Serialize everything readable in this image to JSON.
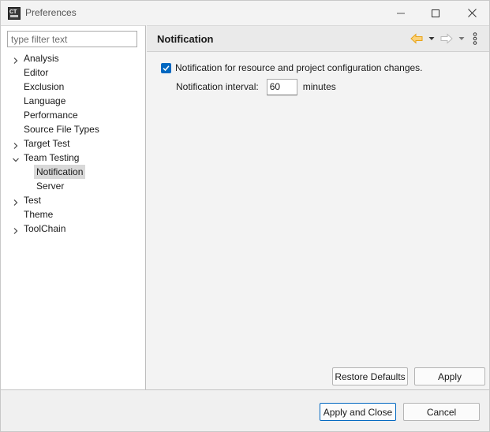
{
  "window": {
    "title": "Preferences",
    "icons": {
      "app": "app-logo-icon",
      "minimize": "minimize-icon",
      "maximize": "maximize-icon",
      "close": "close-icon"
    }
  },
  "filter": {
    "placeholder": "type filter text",
    "value": ""
  },
  "tree": [
    {
      "label": "Analysis",
      "level": 0,
      "expandable": true,
      "expanded": false,
      "selected": false
    },
    {
      "label": "Editor",
      "level": 0,
      "expandable": false,
      "expanded": false,
      "selected": false
    },
    {
      "label": "Exclusion",
      "level": 0,
      "expandable": false,
      "expanded": false,
      "selected": false
    },
    {
      "label": "Language",
      "level": 0,
      "expandable": false,
      "expanded": false,
      "selected": false
    },
    {
      "label": "Performance",
      "level": 0,
      "expandable": false,
      "expanded": false,
      "selected": false
    },
    {
      "label": "Source File Types",
      "level": 0,
      "expandable": false,
      "expanded": false,
      "selected": false
    },
    {
      "label": "Target Test",
      "level": 0,
      "expandable": true,
      "expanded": false,
      "selected": false
    },
    {
      "label": "Team Testing",
      "level": 0,
      "expandable": true,
      "expanded": true,
      "selected": false
    },
    {
      "label": "Notification",
      "level": 1,
      "expandable": false,
      "expanded": false,
      "selected": true
    },
    {
      "label": "Server",
      "level": 1,
      "expandable": false,
      "expanded": false,
      "selected": false
    },
    {
      "label": "Test",
      "level": 0,
      "expandable": true,
      "expanded": false,
      "selected": false
    },
    {
      "label": "Theme",
      "level": 0,
      "expandable": false,
      "expanded": false,
      "selected": false
    },
    {
      "label": "ToolChain",
      "level": 0,
      "expandable": true,
      "expanded": false,
      "selected": false
    }
  ],
  "page": {
    "title": "Notification",
    "nav_icons": {
      "back": "back-arrow-icon",
      "forward": "forward-arrow-icon",
      "dropdown": "dropdown-caret-icon",
      "menu": "view-menu-icon"
    },
    "notify_checkbox": {
      "label": "Notification for resource and project configuration changes.",
      "checked": true
    },
    "interval": {
      "label": "Notification interval:",
      "value": "60",
      "unit": "minutes"
    },
    "restore_defaults_label": "Restore Defaults",
    "apply_label": "Apply"
  },
  "footer": {
    "apply_close_label": "Apply and Close",
    "cancel_label": "Cancel"
  },
  "colors": {
    "accent": "#0067c0",
    "selection": "#d9d9d9",
    "back_arrow": "#e8a317",
    "forward_arrow": "#b8b8b8"
  }
}
